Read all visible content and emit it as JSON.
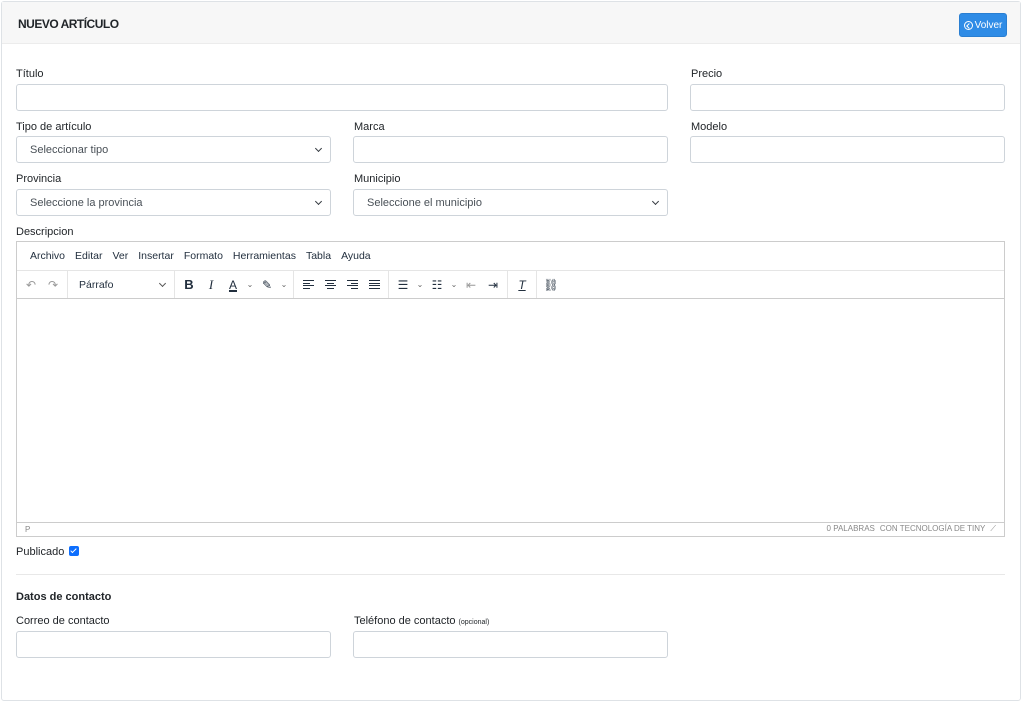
{
  "header": {
    "title": "NUEVO ARTÍCULO",
    "back_label": "Volver"
  },
  "form": {
    "titulo_label": "Título",
    "precio_label": "Precio",
    "tipo_label": "Tipo de artículo",
    "tipo_value": "Seleccionar tipo",
    "marca_label": "Marca",
    "modelo_label": "Modelo",
    "provincia_label": "Provincia",
    "provincia_value": "Seleccione la provincia",
    "municipio_label": "Municipio",
    "municipio_value": "Seleccione el municipio",
    "descripcion_label": "Descripcion",
    "publicado_label": "Publicado"
  },
  "editor": {
    "menu": [
      "Archivo",
      "Editar",
      "Ver",
      "Insertar",
      "Formato",
      "Herramientas",
      "Tabla",
      "Ayuda"
    ],
    "block_format": "Párrafo",
    "status_path": "P",
    "word_count": "0 PALABRAS",
    "powered_by": "CON TECNOLOGÍA DE TINY"
  },
  "contact": {
    "section_title": "Datos de contacto",
    "email_label": "Correo de contacto",
    "phone_label": "Teléfono de contacto",
    "phone_optional": "(opcional)"
  },
  "colors": {
    "primary": "#2f8ce6",
    "checkbox": "#0d6efd"
  }
}
